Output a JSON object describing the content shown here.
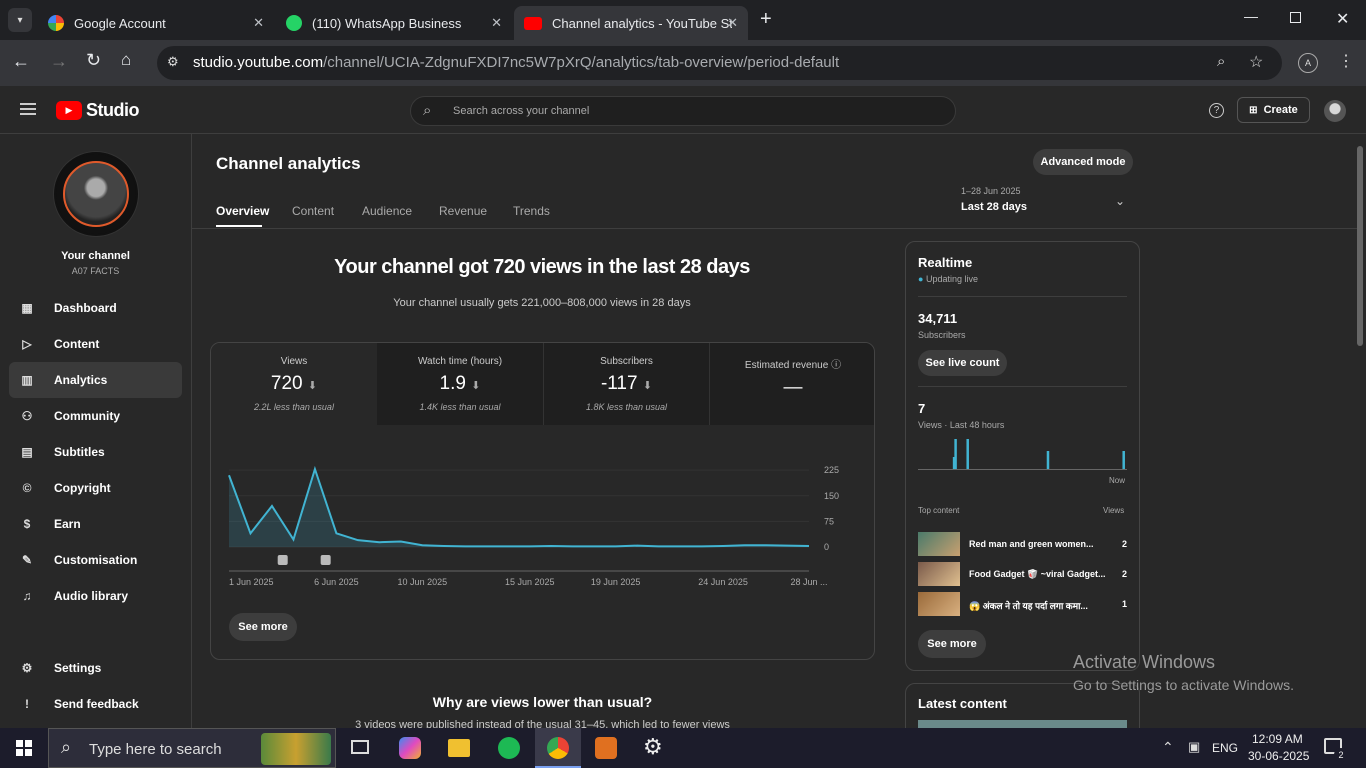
{
  "browser": {
    "tabs": [
      {
        "title": "Google Account"
      },
      {
        "title": "(110) WhatsApp Business"
      },
      {
        "title": "Channel analytics - YouTube Stu"
      }
    ],
    "url_host": "studio.youtube.com",
    "url_path": "/channel/UCIA-ZdgnuFXDI7nc5W7pXrQ/analytics/tab-overview/period-default",
    "profile_letter": "A"
  },
  "header": {
    "logo_text": "Studio",
    "search_placeholder": "Search across your channel",
    "create_label": "Create"
  },
  "sidebar": {
    "channel_label": "Your channel",
    "channel_name": "A07 FACTS",
    "items": [
      {
        "label": "Dashboard",
        "icon": "dashboard-icon"
      },
      {
        "label": "Content",
        "icon": "content-icon"
      },
      {
        "label": "Analytics",
        "icon": "analytics-icon"
      },
      {
        "label": "Community",
        "icon": "community-icon"
      },
      {
        "label": "Subtitles",
        "icon": "subtitles-icon"
      },
      {
        "label": "Copyright",
        "icon": "copyright-icon"
      },
      {
        "label": "Earn",
        "icon": "earn-icon"
      },
      {
        "label": "Customisation",
        "icon": "customisation-icon"
      },
      {
        "label": "Audio library",
        "icon": "audio-library-icon"
      }
    ],
    "bottom": [
      {
        "label": "Settings"
      },
      {
        "label": "Send feedback"
      }
    ]
  },
  "main": {
    "title": "Channel analytics",
    "advanced_mode": "Advanced mode",
    "tabs": [
      "Overview",
      "Content",
      "Audience",
      "Revenue",
      "Trends"
    ],
    "period_range": "1–28 Jun 2025",
    "period_label": "Last 28 days",
    "headline": "Your channel got 720 views in the last 28 days",
    "subline": "Your channel usually gets 221,000–808,000 views in 28 days",
    "kpis": [
      {
        "label": "Views",
        "value": "720",
        "sub": "2.2L less than usual"
      },
      {
        "label": "Watch time (hours)",
        "value": "1.9",
        "sub": "1.4K less than usual"
      },
      {
        "label": "Subscribers",
        "value": "-117",
        "sub": "1.8K less than usual"
      },
      {
        "label": "Estimated revenue",
        "value": "—",
        "sub": ""
      }
    ],
    "see_more": "See more",
    "why_title": "Why are views lower than usual?",
    "why_text": "3 videos were published instead of the usual 31–45, which led to fewer views"
  },
  "chart_data": {
    "type": "area",
    "x": [
      "1 Jun",
      "2 Jun",
      "3 Jun",
      "4 Jun",
      "5 Jun",
      "6 Jun",
      "7 Jun",
      "8 Jun",
      "9 Jun",
      "10 Jun",
      "11 Jun",
      "12 Jun",
      "13 Jun",
      "14 Jun",
      "15 Jun",
      "16 Jun",
      "17 Jun",
      "18 Jun",
      "19 Jun",
      "20 Jun",
      "21 Jun",
      "22 Jun",
      "23 Jun",
      "24 Jun",
      "25 Jun",
      "26 Jun",
      "27 Jun",
      "28 Jun"
    ],
    "values": [
      210,
      40,
      120,
      22,
      228,
      40,
      20,
      14,
      16,
      5,
      3,
      2,
      2,
      2,
      2,
      3,
      2,
      2,
      2,
      4,
      2,
      2,
      2,
      3,
      5,
      5,
      4,
      3
    ],
    "xtick_labels": [
      "1 Jun 2025",
      "6 Jun 2025",
      "10 Jun 2025",
      "15 Jun 2025",
      "19 Jun 2025",
      "24 Jun 2025",
      "28 Jun ..."
    ],
    "xtick_index": [
      0,
      5,
      9,
      14,
      18,
      23,
      27
    ],
    "yticks": [
      0,
      75,
      150,
      225
    ],
    "ylim": [
      0,
      240
    ],
    "upload_markers_index": [
      2,
      4
    ],
    "color": "#41b4d2"
  },
  "realtime": {
    "title": "Realtime",
    "live": "Updating live",
    "subs_value": "34,711",
    "subs_label": "Subscribers",
    "see_live": "See live count",
    "views_value": "7",
    "views_label": "Views · Last 48 hours",
    "now_label": "Now",
    "bars": [
      0,
      0,
      0,
      0,
      0,
      0,
      0,
      0,
      0,
      0,
      0,
      0,
      0,
      0,
      0,
      0,
      0,
      0,
      0,
      0,
      0,
      0,
      0,
      2,
      5,
      0,
      0,
      0,
      0,
      0,
      0,
      0,
      5,
      0,
      0,
      0,
      0,
      0,
      0,
      0,
      0,
      0,
      0,
      0,
      0,
      0,
      0,
      0,
      0,
      0,
      0,
      0,
      0,
      0,
      0,
      0,
      0,
      0,
      0,
      0,
      0,
      0,
      0,
      0,
      0,
      0,
      0,
      0,
      0,
      0,
      0,
      0,
      0,
      0,
      0,
      0,
      0,
      0,
      0,
      0,
      0,
      0,
      0,
      0,
      0,
      3,
      0,
      0,
      0,
      0,
      0,
      0,
      0,
      0,
      0,
      0,
      0,
      0,
      0,
      0,
      0,
      0,
      0,
      0,
      0,
      0,
      0,
      0,
      0,
      0,
      0,
      0,
      0,
      0,
      0,
      0,
      0,
      0,
      0,
      0,
      0,
      0,
      0,
      0,
      0,
      0,
      0,
      0,
      0,
      0,
      0,
      0,
      0,
      0,
      0,
      3,
      0,
      0
    ],
    "top_label": "Top content",
    "top_views_label": "Views",
    "top": [
      {
        "title": "Red man and green women...",
        "views": "2"
      },
      {
        "title": "Food Gadget 🥡 ~viral Gadget...",
        "views": "2"
      },
      {
        "title": "😱 अंकल ने तो यह पर्दा लगा कमा...",
        "views": "1"
      }
    ],
    "see_more": "See more"
  },
  "latest": {
    "title": "Latest content"
  },
  "watermark": {
    "line1": "Activate Windows",
    "line2": "Go to Settings to activate Windows."
  },
  "taskbar": {
    "search": "Type here to search",
    "lang": "ENG",
    "time": "12:09 AM",
    "date": "30-06-2025",
    "notif": "2"
  }
}
